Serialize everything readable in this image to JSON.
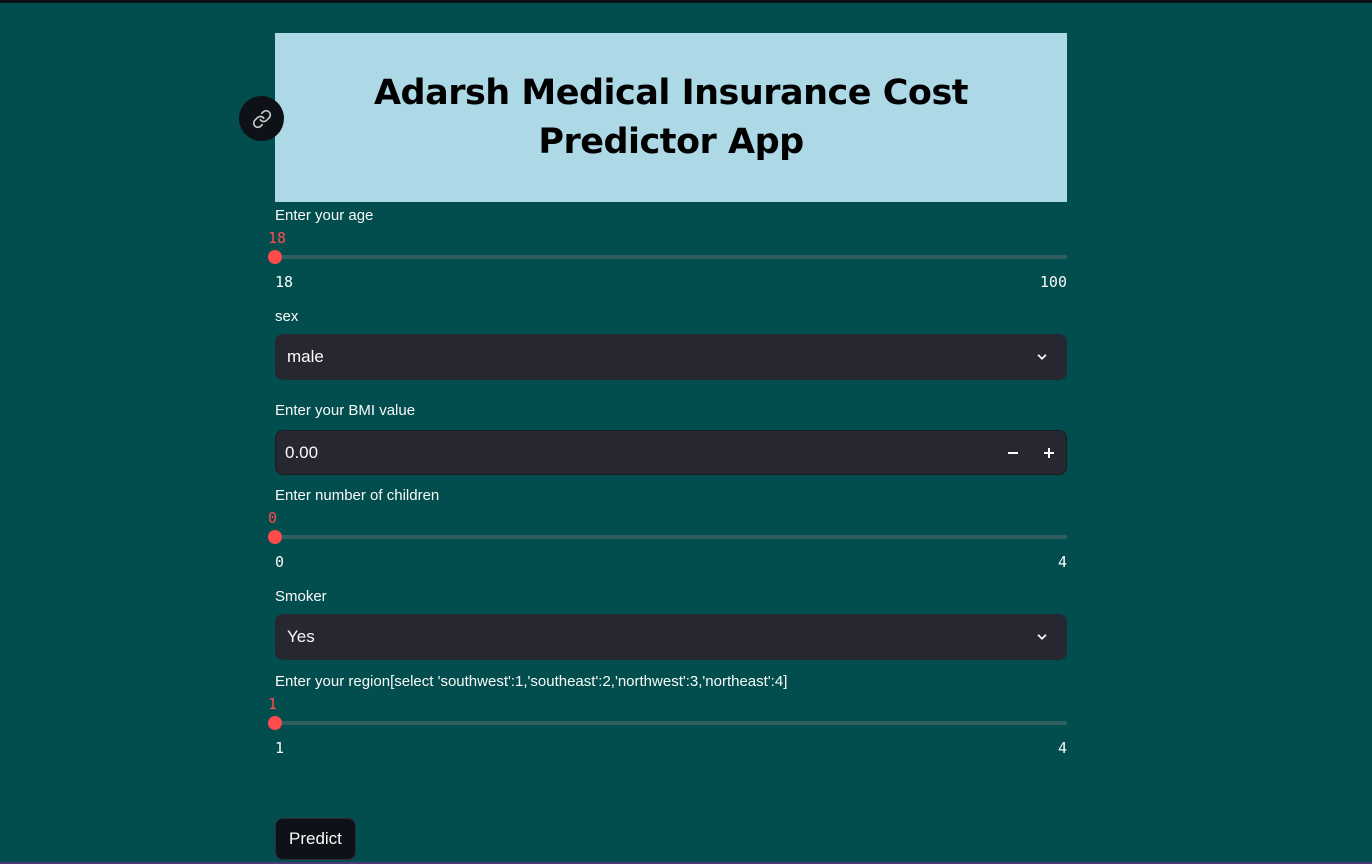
{
  "app": {
    "title": "Adarsh Medical Insurance Cost Predictor App"
  },
  "age": {
    "label": "Enter your age",
    "value": "18",
    "min": "18",
    "max": "100"
  },
  "sex": {
    "label": "sex",
    "selected": "male"
  },
  "bmi": {
    "label": "Enter your BMI value",
    "value": "0.00",
    "decrement": "−",
    "increment": "+"
  },
  "children": {
    "label": "Enter number of children",
    "value": "0",
    "min": "0",
    "max": "4"
  },
  "smoker": {
    "label": "Smoker",
    "selected": "Yes"
  },
  "region": {
    "label": "Enter your region[select 'southwest':1,'southeast':2,'northwest':3,'northeast':4]",
    "value": "1",
    "min": "1",
    "max": "4"
  },
  "predict": {
    "label": "Predict"
  },
  "colors": {
    "background": "#024d4d",
    "title_background": "#add8e6",
    "accent": "#ff4b4b",
    "input_background": "#262730"
  },
  "icons": {
    "anchor": "link-icon",
    "select_arrow": "chevron-down-icon"
  }
}
